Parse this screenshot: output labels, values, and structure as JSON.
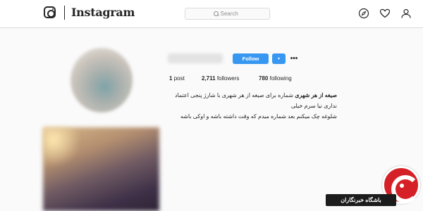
{
  "header": {
    "wordmark": "Instagram",
    "search_placeholder": "Search",
    "icons": [
      "instagram-logo-icon",
      "compass-icon",
      "heart-icon",
      "user-icon"
    ]
  },
  "profile": {
    "username": "",
    "follow_label": "Follow",
    "dropdown_glyph": "▾",
    "more_glyph": "•••",
    "stats": {
      "posts_count": "1",
      "posts_label": "post",
      "followers_count": "2,711",
      "followers_label": "followers",
      "following_count": "780",
      "following_label": "following"
    },
    "bio": {
      "name": "صیغه از هر شهری",
      "line1": "شماره برای صیغه از هر شهری با شارژ پنجی اعتماد نداری نیا سرم خیلی",
      "line2": "شلوغه چک میکنم بعد شماره میدم که وقت داشته باشه و اوکی باشه"
    }
  },
  "watermark": {
    "text": "باشگاه خبرنگاران",
    "color": "#d42026"
  },
  "colors": {
    "accent": "#3897f0",
    "border": "#dbdbdb",
    "background": "#fafafa"
  }
}
